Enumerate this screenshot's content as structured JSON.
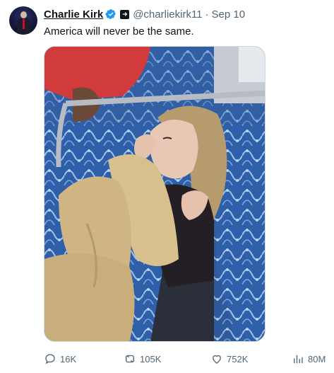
{
  "author": {
    "display_name": "Charlie Kirk",
    "handle": "@charliekirk11",
    "date": "Sep 10",
    "separator": "·"
  },
  "tweet": {
    "text": "America will never be the same."
  },
  "actions": {
    "replies": "16K",
    "reposts": "105K",
    "likes": "752K",
    "views": "80M"
  },
  "icons": {
    "verified": "verified-badge-icon",
    "affiliate": "affiliate-badge-icon",
    "reply": "reply-icon",
    "repost": "repost-icon",
    "like": "heart-icon",
    "views": "views-bar-chart-icon"
  },
  "colors": {
    "verified_blue": "#1d9bf0",
    "muted_text": "#536471",
    "primary_text": "#0f1419"
  }
}
